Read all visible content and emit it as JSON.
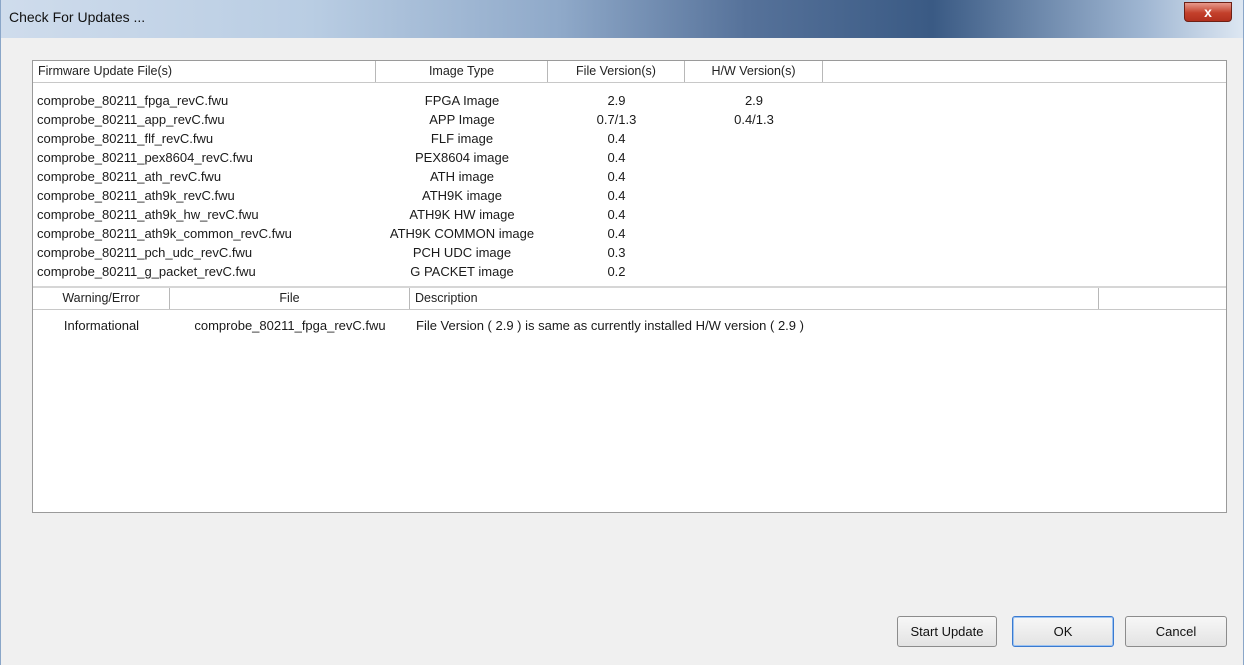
{
  "window": {
    "title": "Check For Updates ...",
    "close_glyph": "x",
    "accent_color": "#3a5a84"
  },
  "firmware_table": {
    "columns": [
      "Firmware Update File(s)",
      "Image Type",
      "File Version(s)",
      "H/W Version(s)"
    ],
    "rows": [
      {
        "file": "comprobe_80211_fpga_revC.fwu",
        "type": "FPGA Image",
        "file_version": "2.9",
        "hw_version": "2.9"
      },
      {
        "file": "comprobe_80211_app_revC.fwu",
        "type": "APP Image",
        "file_version": "0.7/1.3",
        "hw_version": "0.4/1.3"
      },
      {
        "file": "comprobe_80211_flf_revC.fwu",
        "type": "FLF image",
        "file_version": "0.4",
        "hw_version": ""
      },
      {
        "file": "comprobe_80211_pex8604_revC.fwu",
        "type": "PEX8604 image",
        "file_version": "0.4",
        "hw_version": ""
      },
      {
        "file": "comprobe_80211_ath_revC.fwu",
        "type": "ATH image",
        "file_version": "0.4",
        "hw_version": ""
      },
      {
        "file": "comprobe_80211_ath9k_revC.fwu",
        "type": "ATH9K image",
        "file_version": "0.4",
        "hw_version": ""
      },
      {
        "file": "comprobe_80211_ath9k_hw_revC.fwu",
        "type": "ATH9K HW image",
        "file_version": "0.4",
        "hw_version": ""
      },
      {
        "file": "comprobe_80211_ath9k_common_revC.fwu",
        "type": "ATH9K COMMON image",
        "file_version": "0.4",
        "hw_version": ""
      },
      {
        "file": "comprobe_80211_pch_udc_revC.fwu",
        "type": "PCH UDC image",
        "file_version": "0.3",
        "hw_version": ""
      },
      {
        "file": "comprobe_80211_g_packet_revC.fwu",
        "type": "G PACKET image",
        "file_version": "0.2",
        "hw_version": ""
      }
    ]
  },
  "messages_table": {
    "columns": [
      "Warning/Error",
      "File",
      "Description"
    ],
    "rows": [
      {
        "level": "Informational",
        "file": "comprobe_80211_fpga_revC.fwu",
        "description": "File Version ( 2.9 ) is same as currently installed H/W version ( 2.9 )"
      }
    ]
  },
  "buttons": {
    "start_update": "Start Update",
    "ok": "OK",
    "cancel": "Cancel"
  }
}
